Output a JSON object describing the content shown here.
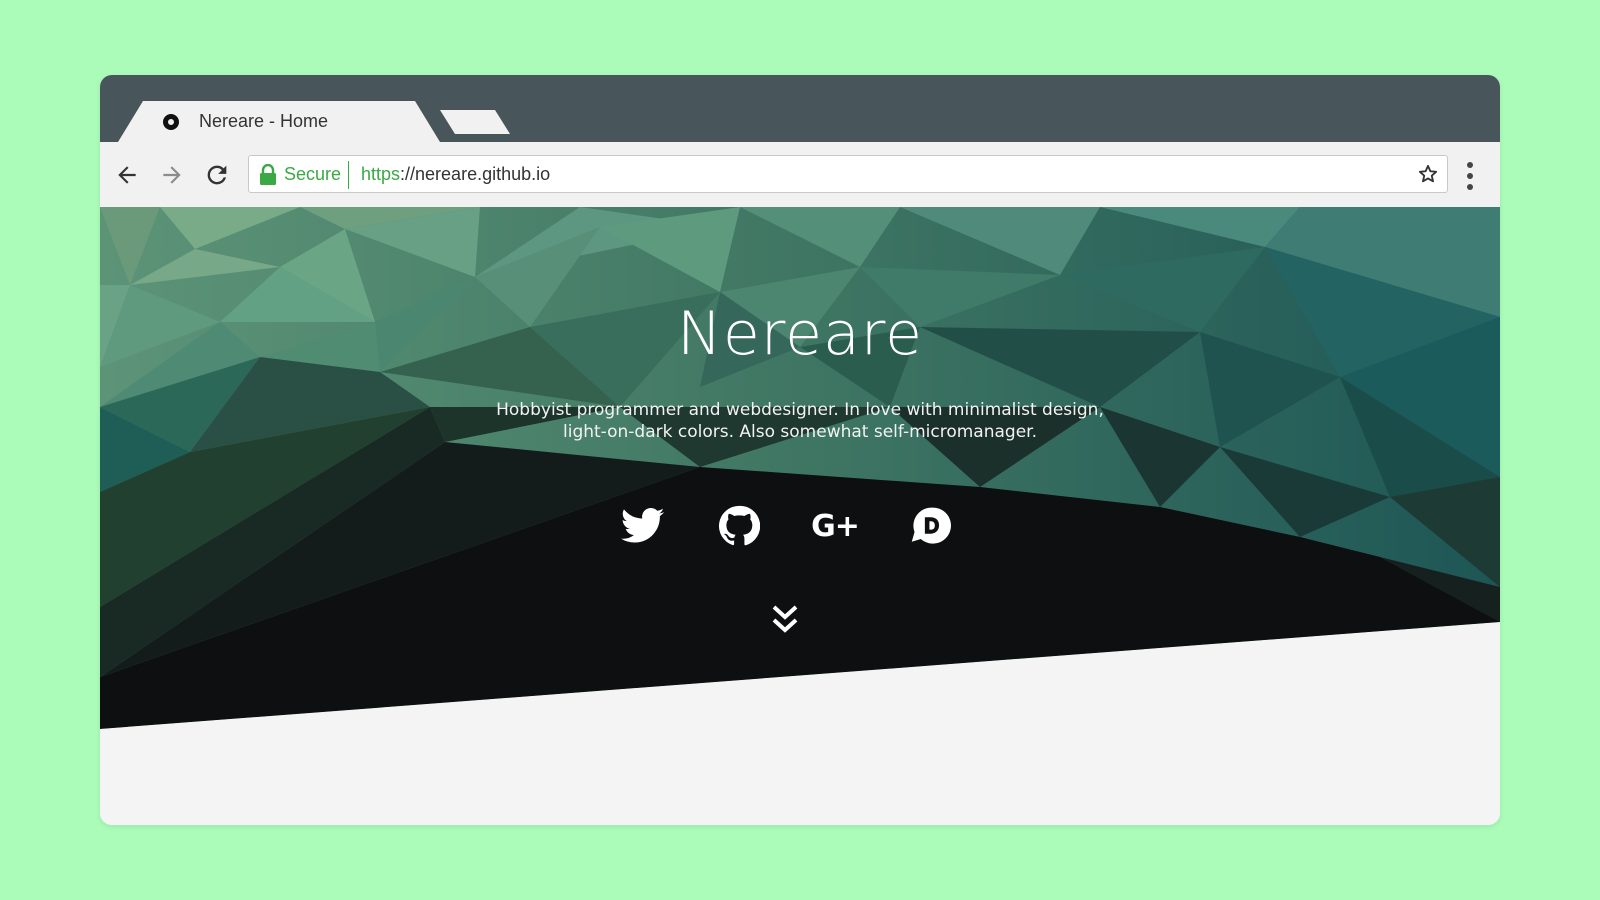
{
  "browser": {
    "tab": {
      "title": "Nereare - Home",
      "favicon": "circle-logo-icon"
    },
    "toolbar": {
      "back_icon": "arrow-left-icon",
      "forward_icon": "arrow-right-icon",
      "reload_icon": "reload-icon",
      "secure_label": "Secure",
      "url_scheme": "https",
      "url_rest": "://nereare.github.io",
      "bookmark_icon": "star-icon",
      "menu_icon": "kebab-menu-icon"
    },
    "colors": {
      "titlebar": "#48565b",
      "toolbar": "#f1f1f1",
      "secure_green": "#3aa845",
      "page_background": "#abfbb9"
    }
  },
  "page": {
    "hero": {
      "title": "Nereare",
      "description_line1": "Hobbyist programmer and webdesigner. In love with minimalist design,",
      "description_line2": "light-on-dark colors. Also somewhat self-micromanager."
    },
    "social_links": [
      {
        "name": "Twitter",
        "icon": "twitter-icon"
      },
      {
        "name": "GitHub",
        "icon": "github-icon"
      },
      {
        "name": "Google+",
        "icon": "google-plus-icon",
        "glyph": "G+"
      },
      {
        "name": "Disqus",
        "icon": "disqus-icon"
      }
    ],
    "scroll_icon": "double-chevron-down-icon"
  }
}
